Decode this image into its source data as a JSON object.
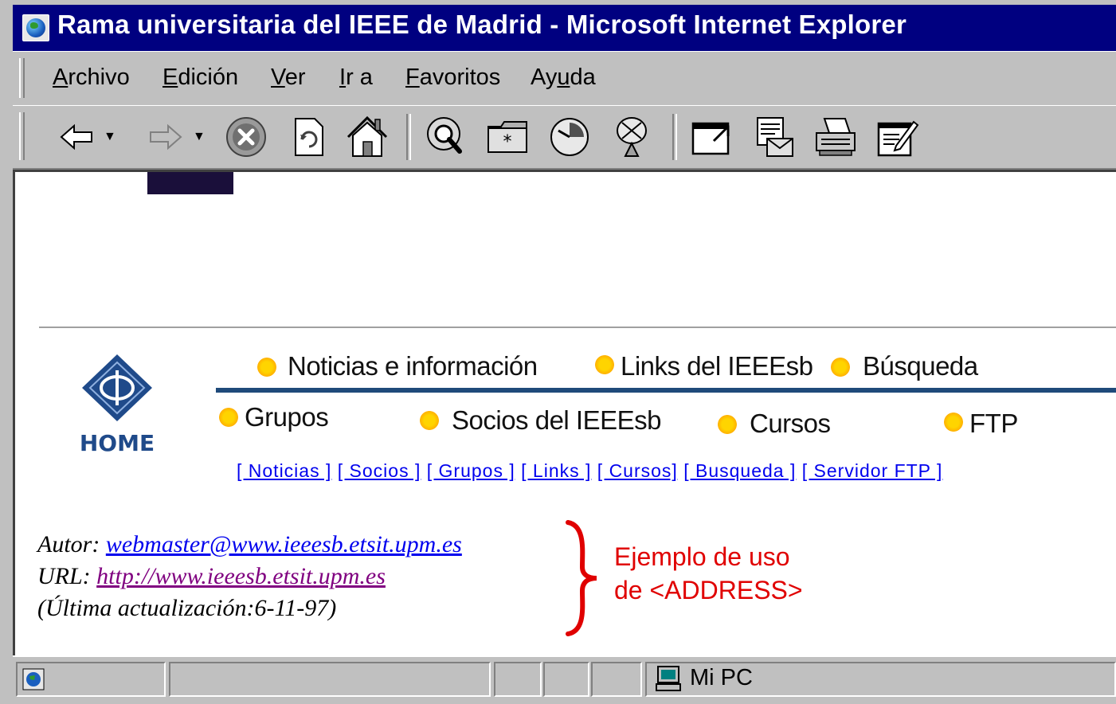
{
  "window": {
    "title": "Rama universitaria del IEEE de Madrid - Microsoft Internet Explorer"
  },
  "menu": {
    "items": [
      {
        "label": "Archivo",
        "ul": "A",
        "rest": "rchivo"
      },
      {
        "label": "Edición",
        "ul": "E",
        "rest": "dición"
      },
      {
        "label": "Ver",
        "ul": "V",
        "rest": "er"
      },
      {
        "label": "Ir a",
        "ul": "I",
        "rest": "r a"
      },
      {
        "label": "Favoritos",
        "ul": "F",
        "rest": "avoritos"
      },
      {
        "label": "Ayuda",
        "pre": "Ay",
        "ul": "u",
        "rest": "da"
      }
    ]
  },
  "toolbar": {
    "buttons": [
      "back-icon",
      "forward-icon",
      "stop-icon",
      "refresh-icon",
      "home-icon",
      "search-icon",
      "favorites-icon",
      "history-icon",
      "channels-icon",
      "fullscreen-icon",
      "mail-icon",
      "print-icon",
      "edit-icon"
    ]
  },
  "page": {
    "logo_text": "HOME",
    "nav_row1": [
      "Noticias e información",
      "Links del IEEEsb",
      "Búsqueda"
    ],
    "nav_row2": [
      "Grupos",
      "Socios del IEEEsb",
      "Cursos",
      "FTP"
    ],
    "text_links": [
      "[ Noticias ]",
      "[ Socios ]",
      "[ Grupos ]",
      "[ Links ]",
      "[ Cursos]",
      "[ Busqueda ]",
      "[ Servidor FTP ]"
    ],
    "address": {
      "author_label": "Autor: ",
      "author_link": "webmaster@www.ieeesb.etsit.upm.es",
      "url_label": "URL: ",
      "url_link": "http://www.ieeesb.etsit.upm.es",
      "updated": "(Última actualización:6-11-97)"
    },
    "annotation": {
      "line1": "Ejemplo de uso",
      "line2": "de <ADDRESS>"
    }
  },
  "statusbar": {
    "zone": "Mi PC"
  },
  "colors": {
    "titlebar": "#000080",
    "link": "#0000ee",
    "visited": "#800080",
    "annotation": "#e00000",
    "nav_rule": "#1f4a7a"
  }
}
